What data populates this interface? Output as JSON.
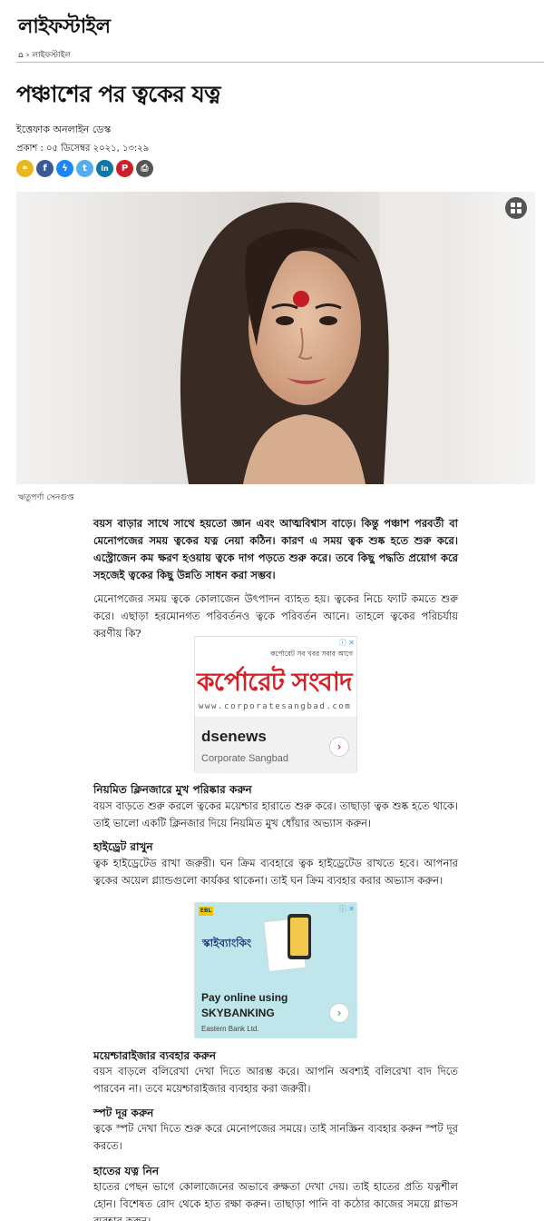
{
  "section": {
    "title": "লাইফস্টাইল"
  },
  "breadcrumb": {
    "home_icon": "home-icon",
    "separator": "›",
    "current": "লাইফস্টাইল"
  },
  "article": {
    "headline": "পঞ্চাশের পর ত্বকের যত্ন",
    "author": "ইত্তেফাক অনলাইন ডেস্ক",
    "published": "প্রকাশ : ০৫ ডিসেম্বর ২০২১, ১৩:২৯",
    "photo_caption": "ঋতুপর্ণা সেনগুপ্ত",
    "lead": "বয়স বাড়ার সাথে সাথে হয়তো জ্ঞান এবং আত্মবিশ্বাস বাড়ে। কিন্তু পঞ্চাশ পরবর্তী বা মেনোপজের সময় ত্বকের যত্ন নেয়া কঠিন। কারণ এ সময় ত্বক শুষ্ক হতে শুরু করে। এস্ট্রোজেন কম ক্ষরণ হওয়ায় ত্বকে দাগ পড়তে শুরু করে। তবে কিছু পদ্ধতি প্রয়োগ করে সহজেই ত্বকের কিছু উন্নতি সাধন করা সম্ভব।",
    "para1": "মেনোপজের সময় ত্বকে কোলাজেন উৎপাদন ব্যাহত হয়। ত্বকের নিচে ফ্যাট কমতে শুরু করে। এছাড়া হরমোনগত পরিবর্তনও ত্বকে পরিবর্তন আনে। তাহলে ত্বকের পরিচর্যায় করণীয় কি?",
    "sections": [
      {
        "heading": "নিয়মিত ক্লিনজারে মুখ পরিষ্কার করুন",
        "text": "বয়স বাড়তে শুরু করলে ত্বকের ময়েশ্চার হারাতে শুরু করে। তাছাড়া ত্বক শুষ্ক হতে থাকে। তাই ভালো একটি ক্লিনজার দিয়ে নিয়মিত মুখ ধোঁয়ার অভ্যাস করুন।"
      },
      {
        "heading": "হাইড্রেট রাখুন",
        "text": "ত্বক হাইড্রেটেড রাখা জরুরী। ঘন ক্রিম ব্যবহারে ত্বক হাইড্রেটেড রাখতে হবে। আপনার ত্বকের অয়েল গ্ল্যান্ডগুলো কার্যকর থাকেনা। তাই ঘন ক্রিম ব্যবহার করার অভ্যাস করুন।"
      },
      {
        "heading": "ময়েশ্চারাইজার ব্যবহার করুন",
        "text": "বয়স বাড়লে বলিরেখা দেখা দিতে আরম্ভ করে। আপনি অবশ্যই বলিরেখা বাদ দিতে পারবেন না। তবে ময়েশ্চারাইজার ব্যবহার করা জরুরী।"
      },
      {
        "heading": "স্পট দূর করুন",
        "text": "ত্বকে স্পট দেখা দিতে শুরু করে মেনোপজের সময়ে। তাই সানস্ক্রিন ব্যবহার করুন স্পট দূর করতে।"
      },
      {
        "heading": "হাতের যত্ন নিন",
        "text": "হাতের পেছন ভাগে কোলাজেনের অভাবে রুক্ষতা দেখা দেয়। তাই হাতের প্রতি যত্নশীল হোন। বিশেষত রোদ থেকে হাত রক্ষা করুন। তাছাড়া পানি বা কঠোর কাজের সময়ে গ্লাভস ব্যবহার করুন।"
      }
    ]
  },
  "share": [
    {
      "name": "link",
      "glyph": "⚭",
      "color": "#e8b81f"
    },
    {
      "name": "facebook",
      "glyph": "f",
      "color": "#3b5998"
    },
    {
      "name": "messenger",
      "glyph": "ϟ",
      "color": "#1b86f7"
    },
    {
      "name": "twitter",
      "glyph": "t",
      "color": "#55acee"
    },
    {
      "name": "linkedin",
      "glyph": "in",
      "color": "#0e76a8"
    },
    {
      "name": "pinterest",
      "glyph": "P",
      "color": "#cb2027"
    },
    {
      "name": "print",
      "glyph": "⎙",
      "color": "#555555"
    }
  ],
  "ads": [
    {
      "tagline": "কর্পোরেট সব খবর সবার আগে",
      "brand": "কর্পোরেট সংবাদ",
      "url": "www.corporatesangbad.com",
      "title": "dsenews",
      "subtitle": "Corporate Sangbad",
      "arrow": "›",
      "close": "ⓘ ✕"
    },
    {
      "brand": "স্কাইব্যাংকিং",
      "title": "Pay online using SKYBANKING",
      "subtitle": "Eastern Bank Ltd.",
      "badge": "EBL",
      "arrow": "›",
      "close": "ⓘ ✕"
    }
  ]
}
